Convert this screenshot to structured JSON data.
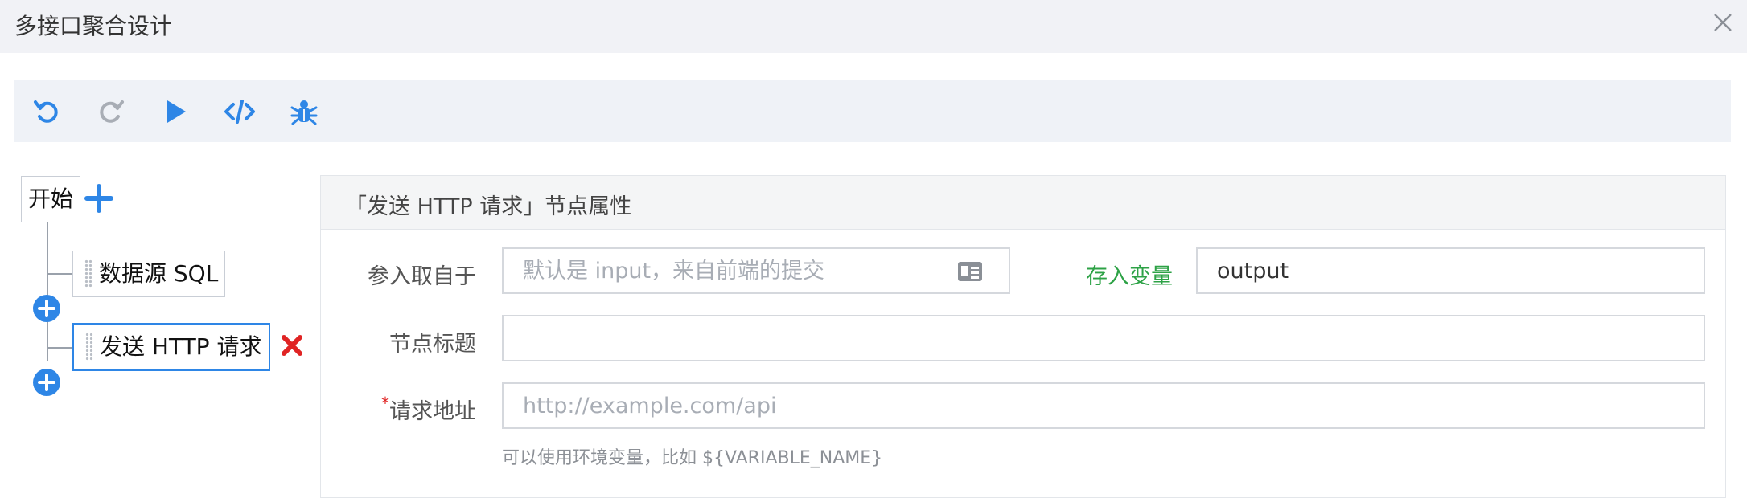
{
  "dialog": {
    "title": "多接口聚合设计"
  },
  "toolbar": {
    "buttons": [
      {
        "icon": "undo-icon"
      },
      {
        "icon": "redo-icon"
      },
      {
        "icon": "play-icon"
      },
      {
        "icon": "code-icon"
      },
      {
        "icon": "debug-bug-icon"
      }
    ],
    "accent": "#2e86e6",
    "disabled_color": "#a8adb5"
  },
  "tree": {
    "start_label": "开始",
    "nodes": [
      {
        "label": "数据源 SQL",
        "active": false
      },
      {
        "label": "发送 HTTP 请求",
        "active": true
      }
    ]
  },
  "panel": {
    "title": "「发送 HTTP 请求」节点属性",
    "fields": {
      "input_source": {
        "label": "参入取自于",
        "placeholder": "默认是 input，来自前端的提交",
        "value": ""
      },
      "store_var": {
        "label": "存入变量",
        "value": "output"
      },
      "node_title": {
        "label": "节点标题",
        "value": ""
      },
      "request_url": {
        "required_mark": "*",
        "label": "请求地址",
        "placeholder": "http://example.com/api",
        "value": "",
        "help": "可以使用环境变量，比如 ${VARIABLE_NAME}"
      }
    }
  },
  "colors": {
    "green_label": "#2da246",
    "delete_red": "#e02424"
  }
}
